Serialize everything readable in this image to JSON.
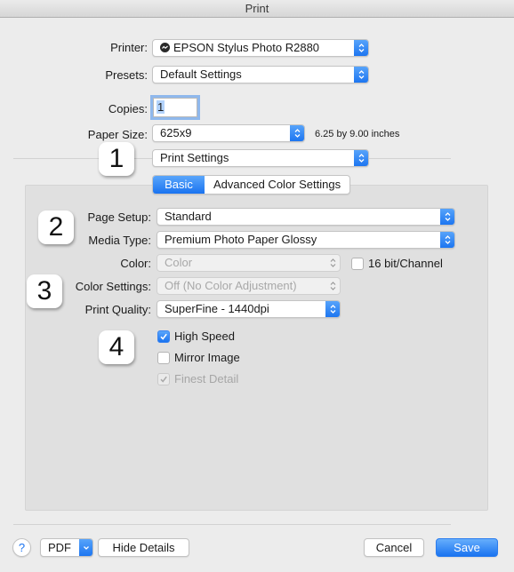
{
  "window": {
    "title": "Print"
  },
  "printer": {
    "label": "Printer:",
    "value": "EPSON Stylus Photo R2880",
    "icon": "printer-status-icon"
  },
  "presets": {
    "label": "Presets:",
    "value": "Default Settings"
  },
  "copies": {
    "label": "Copies:",
    "value": "1"
  },
  "paper_size": {
    "label": "Paper Size:",
    "value": "625x9",
    "dimensions": "6.25 by 9.00 inches"
  },
  "section_popup": {
    "value": "Print Settings"
  },
  "tabs": [
    {
      "label": "Basic",
      "active": true
    },
    {
      "label": "Advanced Color Settings",
      "active": false
    }
  ],
  "badges": [
    "1",
    "2",
    "3",
    "4"
  ],
  "settings": {
    "page_setup": {
      "label": "Page Setup:",
      "value": "Standard"
    },
    "media_type": {
      "label": "Media Type:",
      "value": "Premium Photo Paper Glossy"
    },
    "color": {
      "label": "Color:",
      "value": "Color",
      "enabled": false
    },
    "sixteen_bit": {
      "label": "16 bit/Channel",
      "checked": false
    },
    "color_settings": {
      "label": "Color Settings:",
      "value": "Off (No Color Adjustment)",
      "enabled": false
    },
    "print_quality": {
      "label": "Print Quality:",
      "value": "SuperFine - 1440dpi"
    },
    "high_speed": {
      "label": "High Speed",
      "checked": true
    },
    "mirror_image": {
      "label": "Mirror Image",
      "checked": false
    },
    "finest_detail": {
      "label": "Finest Detail",
      "checked": true,
      "enabled": false
    }
  },
  "footer": {
    "help": "?",
    "pdf": "PDF",
    "hide_details": "Hide Details",
    "cancel": "Cancel",
    "save": "Save"
  },
  "colors": {
    "accent": "#1a73f0",
    "background": "#ececec",
    "panel": "#e0e0e0"
  }
}
